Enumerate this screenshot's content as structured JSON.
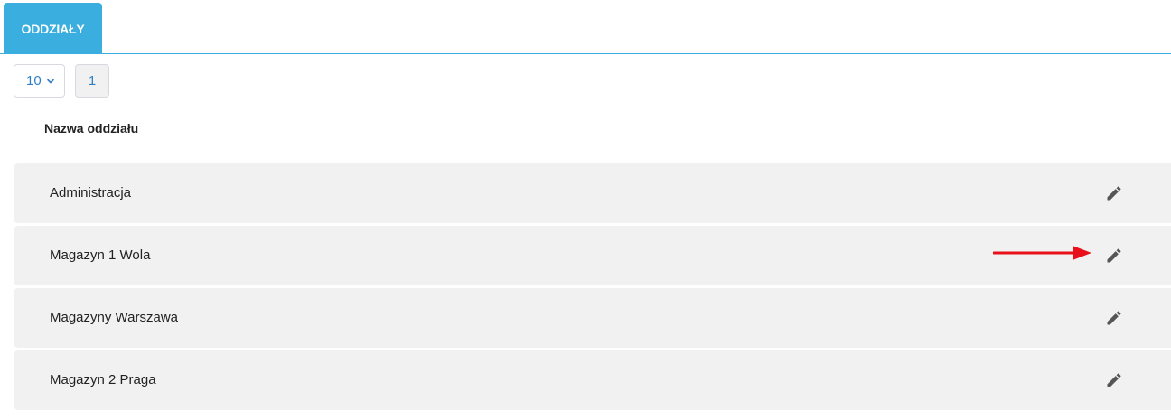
{
  "tabs": [
    {
      "label": "ODDZIAŁY",
      "active": true
    }
  ],
  "pagination": {
    "page_size": "10",
    "current_page": "1"
  },
  "table": {
    "column_header": "Nazwa oddziału",
    "rows": [
      {
        "name": "Administracja"
      },
      {
        "name": "Magazyn 1 Wola"
      },
      {
        "name": "Magazyny Warszawa"
      },
      {
        "name": "Magazyn 2 Praga"
      }
    ],
    "row_action_icon": "pencil-icon"
  },
  "annotation": {
    "icon": "red-arrow-right",
    "color": "#e8111b"
  },
  "colors": {
    "accent": "#3aaede",
    "link": "#2f7fc4",
    "row_bg": "#f1f1f1"
  }
}
